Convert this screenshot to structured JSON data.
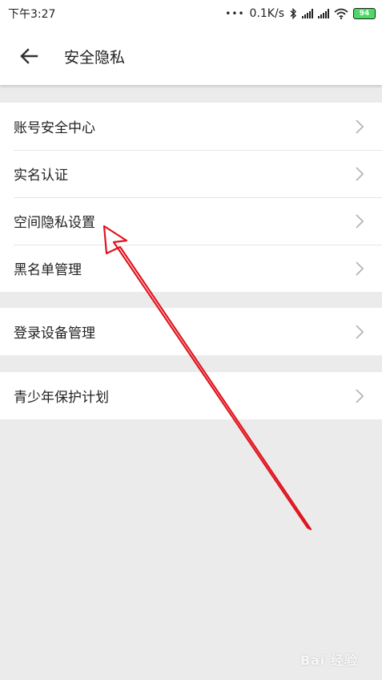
{
  "status_bar": {
    "time": "下午3:27",
    "network_speed": "0.1K/s",
    "battery_level": "94",
    "icons": [
      "bluetooth-icon",
      "signal-icon",
      "signal-icon",
      "wifi-icon",
      "battery-icon"
    ]
  },
  "header": {
    "title": "安全隐私",
    "back_icon": "arrow-left-icon"
  },
  "groups": [
    {
      "items": [
        {
          "label": "账号安全中心"
        },
        {
          "label": "实名认证"
        },
        {
          "label": "空间隐私设置"
        },
        {
          "label": "黑名单管理"
        }
      ]
    },
    {
      "items": [
        {
          "label": "登录设备管理"
        }
      ]
    },
    {
      "items": [
        {
          "label": "青少年保护计划"
        }
      ]
    }
  ],
  "annotation": {
    "color": "#e0141e",
    "points_to": "空间隐私设置"
  },
  "watermark": {
    "text": "Bai 经验"
  },
  "colors": {
    "background": "#ebebeb",
    "surface": "#ffffff",
    "battery": "#4cd964"
  }
}
